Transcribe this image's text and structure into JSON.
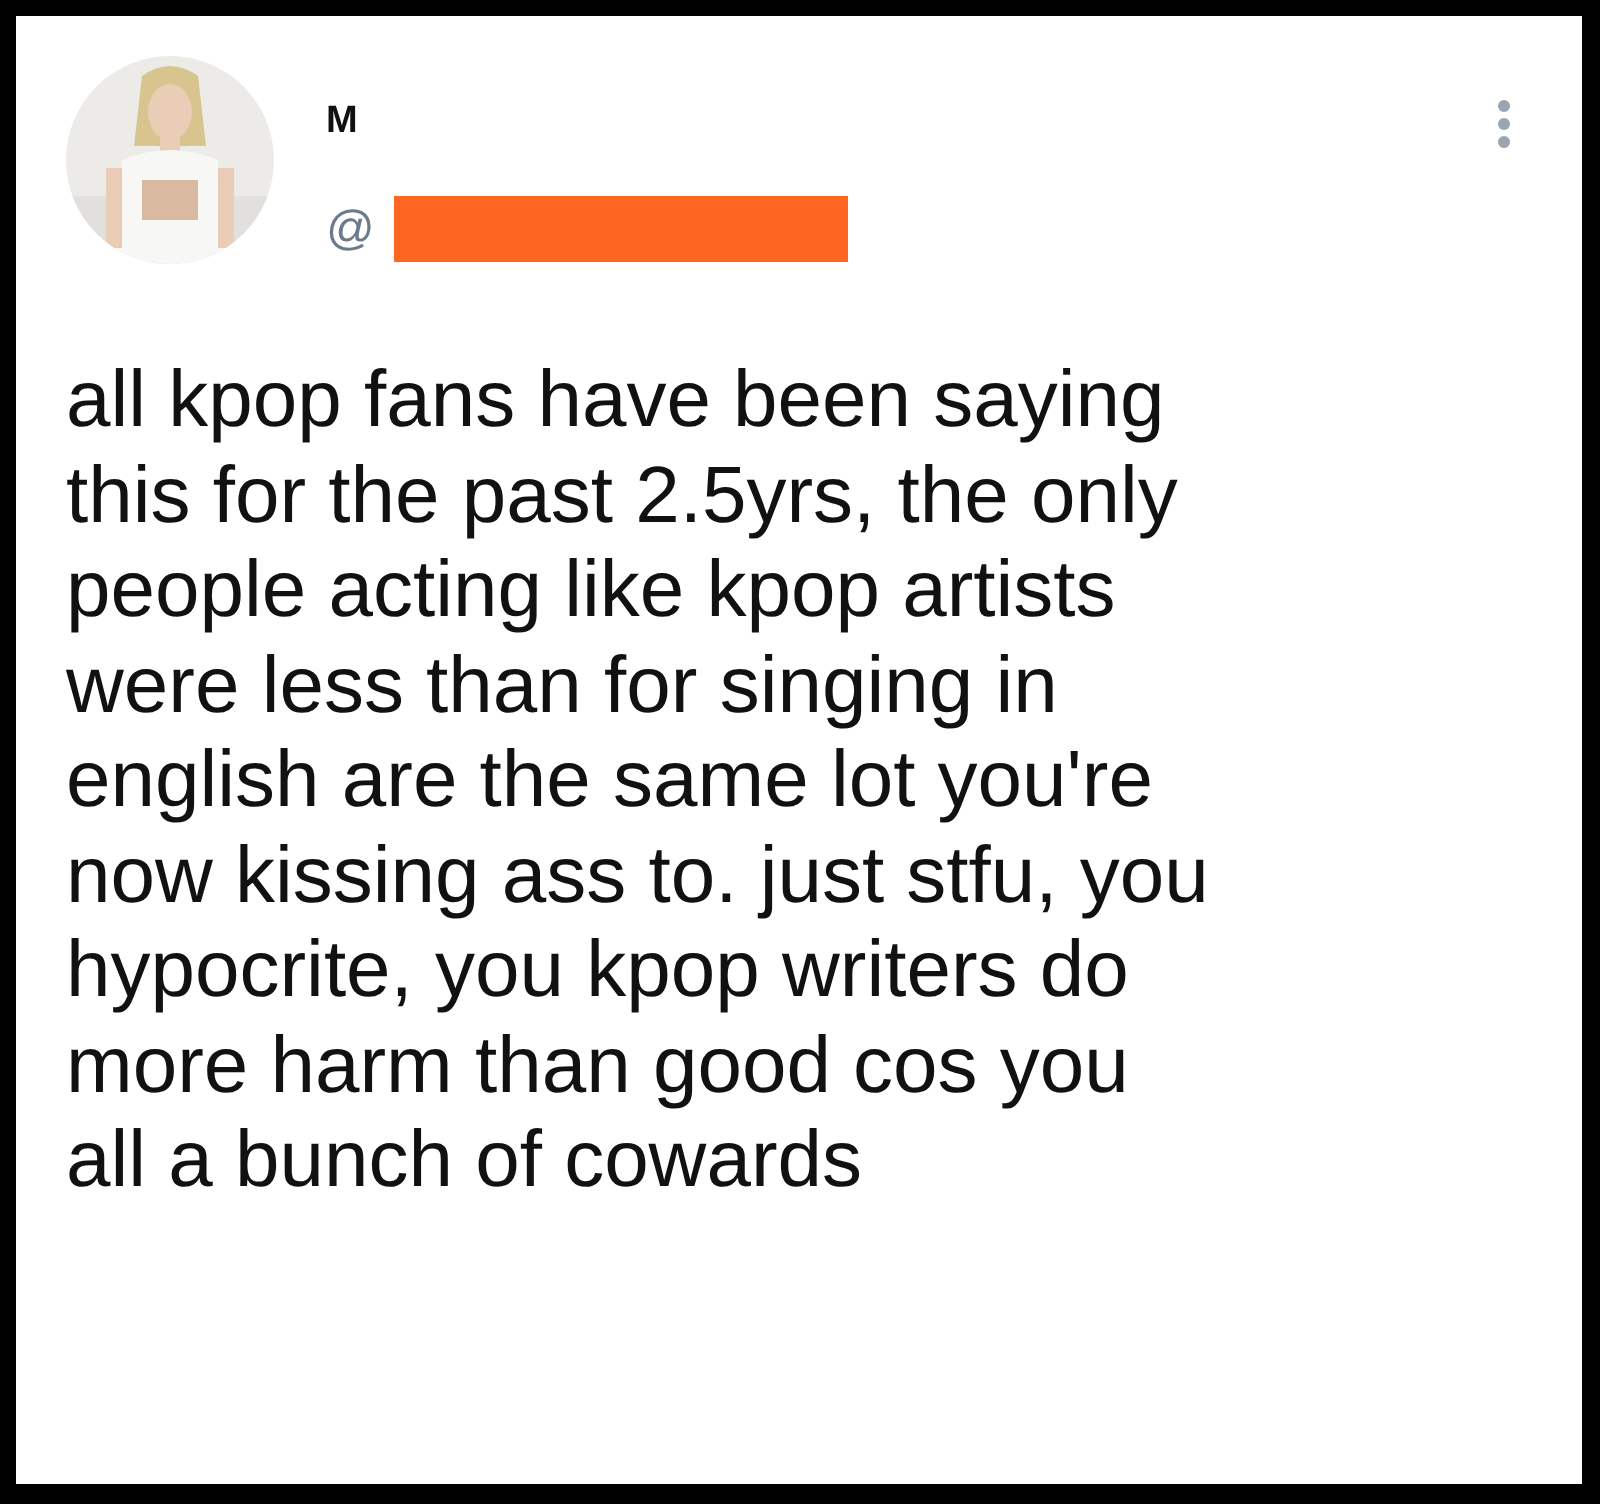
{
  "author": {
    "name": "M",
    "handle": "@",
    "handle_redacted": true
  },
  "tweet": {
    "lines": [
      "all kpop fans have been saying",
      "this for the past 2.5yrs, the only",
      "people acting like kpop artists",
      "were less than for singing in",
      "english are the same lot you're",
      "now kissing ass to. just stfu, you",
      "hypocrite, you kpop writers do",
      "more harm than good cos you",
      "all a bunch of cowards"
    ]
  }
}
